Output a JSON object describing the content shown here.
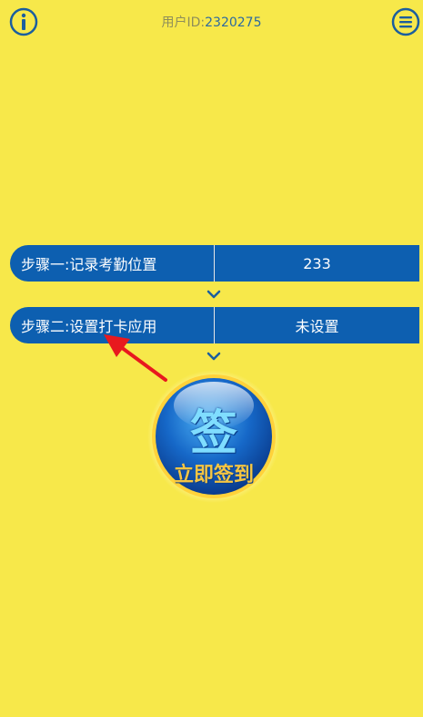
{
  "header": {
    "user_id_label": "用户ID:",
    "user_id_value": "2320275"
  },
  "steps": [
    {
      "label": "步骤一:记录考勤位置",
      "value": "233"
    },
    {
      "label": "步骤二:设置打卡应用",
      "value": "未设置"
    }
  ],
  "sign_button": {
    "char": "签",
    "text": "立即签到"
  },
  "colors": {
    "background": "#F7E84A",
    "step_bar": "#0D5FB0",
    "icon": "#1B5E9E",
    "arrow": "#E8191E"
  },
  "icons": {
    "info": "info-icon",
    "menu": "menu-icon",
    "chevron": "chevron-down-icon"
  }
}
